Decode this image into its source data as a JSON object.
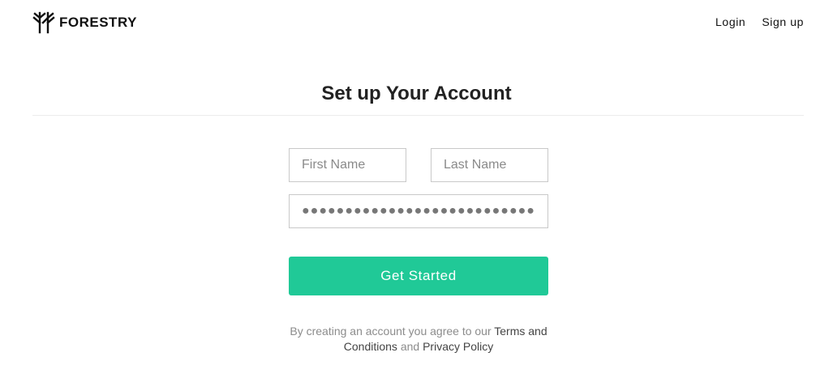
{
  "header": {
    "brand_name": "FORESTRY",
    "logo_icon": "forestry-tree-icon",
    "nav": {
      "login_label": "Login",
      "signup_label": "Sign up"
    }
  },
  "main": {
    "title": "Set up Your Account",
    "form": {
      "first_name": {
        "placeholder": "First Name",
        "value": ""
      },
      "last_name": {
        "placeholder": "Last Name",
        "value": ""
      },
      "password": {
        "masked_value": "●●●●●●●●●●●●●●●●●●●●●●●●●●●●●●●●●●●●"
      },
      "submit_label": "Get Started"
    },
    "legal": {
      "prefix": "By creating an account you agree to our ",
      "terms_label": "Terms and Conditions",
      "conjunction": " and ",
      "privacy_label": "Privacy Policy"
    }
  },
  "colors": {
    "accent": "#20c997",
    "text_dark": "#222222",
    "text_muted": "#8c8c8c",
    "border": "#c9c9c9"
  }
}
